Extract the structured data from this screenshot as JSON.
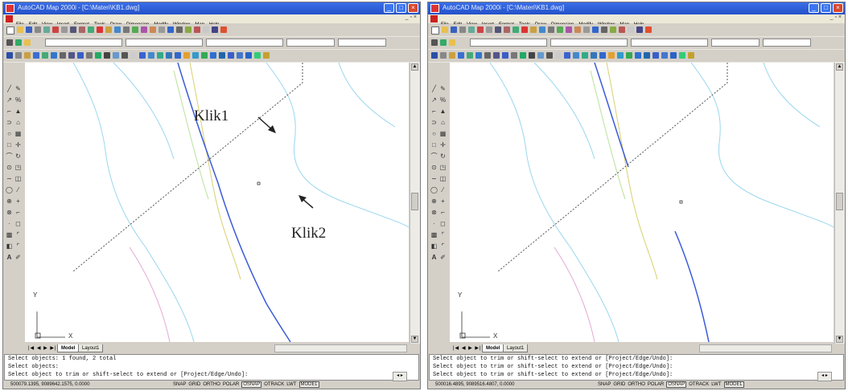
{
  "colors": {
    "titlebar": "#2451c9",
    "polyline_blue": "#3b5bd8",
    "lines_cyan": "#9ad6ee",
    "lines_yellow": "#d8d070",
    "lines_green": "#b8e29a",
    "lines_pink": "#e4a8d6",
    "dotted": "#555555"
  },
  "left_window": {
    "title": "AutoCAD Map 2000i - [C:\\Materi\\KB1.dwg]",
    "menu": [
      "File",
      "Edit",
      "View",
      "Insert",
      "Format",
      "Tools",
      "Draw",
      "Dimension",
      "Modify",
      "Window",
      "Map",
      "Help"
    ],
    "annotations": {
      "klik1": "Klik1",
      "klik2": "Klik2"
    },
    "axis": {
      "x": "X",
      "y": "Y"
    },
    "tabs": {
      "nav": "|◀ ◀ ▶ ▶|",
      "model": "Model",
      "layout": "Layout1"
    },
    "command_lines": [
      "Select objects: 1 found, 2 total",
      "Select objects:",
      "Select object to trim or shift-select to extend or [Project/Edge/Undo]:"
    ],
    "coords": "500079.1395, 9089642.1575, 0.0000",
    "status_buttons": [
      "SNAP",
      "GRID",
      "ORTHO",
      "POLAR",
      "OSNAP",
      "OTRACK",
      "LWT",
      "MODEL"
    ],
    "status_active": [
      "OSNAP",
      "MODEL"
    ]
  },
  "right_window": {
    "title": "AutoCAD Map 2000i - [C:\\Materi\\KB1.dwg]",
    "menu": [
      "File",
      "Edit",
      "View",
      "Insert",
      "Format",
      "Tools",
      "Draw",
      "Dimension",
      "Modify",
      "Window",
      "Map",
      "Help"
    ],
    "axis": {
      "x": "X",
      "y": "Y"
    },
    "tabs": {
      "nav": "|◀ ◀ ▶ ▶|",
      "model": "Model",
      "layout": "Layout1"
    },
    "command_lines": [
      "Select object to trim or shift-select to extend or [Project/Edge/Undo]:",
      "Select object to trim or shift-select to extend or [Project/Edge/Undo]:",
      "Select object to trim or shift-select to extend or [Project/Edge/Undo]:"
    ],
    "coords": "500016.4895, 9089516.4807, 0.0000",
    "status_buttons": [
      "SNAP",
      "GRID",
      "ORTHO",
      "POLAR",
      "OSNAP",
      "OTRACK",
      "LWT",
      "MODEL"
    ],
    "status_active": [
      "OSNAP",
      "MODEL"
    ]
  }
}
